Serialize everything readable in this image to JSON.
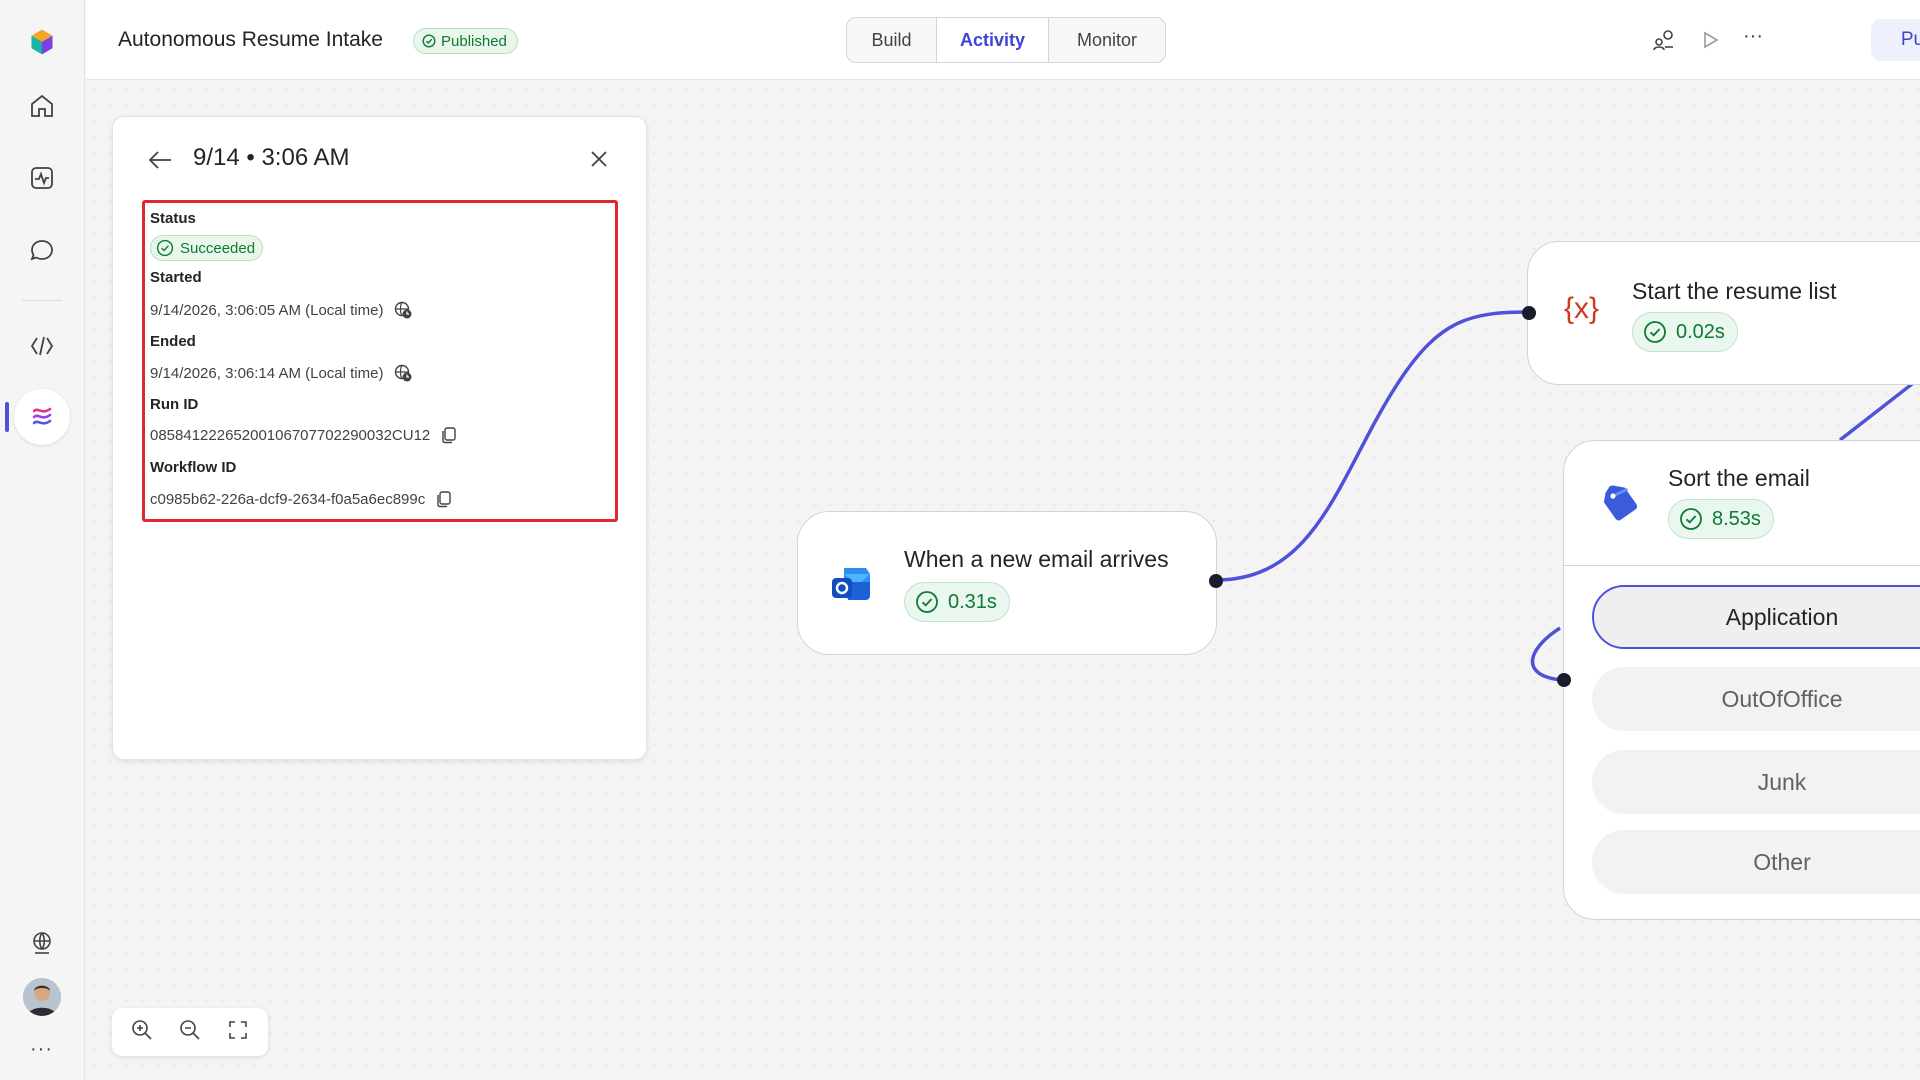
{
  "app": {
    "title": "Autonomous Resume Intake",
    "status_badge": "Published"
  },
  "tabs": [
    {
      "label": "Build",
      "active": false
    },
    {
      "label": "Activity",
      "active": true
    },
    {
      "label": "Monitor",
      "active": false
    }
  ],
  "toolbar": {
    "publish_label": "Publish",
    "more_label": "···"
  },
  "rail": {
    "more_label": "···"
  },
  "run_panel": {
    "title": "9/14 • 3:06 AM",
    "status_label": "Status",
    "status_value": "Succeeded",
    "started_label": "Started",
    "started_value": "9/14/2026, 3:06:05 AM (Local time)",
    "ended_label": "Ended",
    "ended_value": "9/14/2026, 3:06:14 AM (Local time)",
    "run_id_label": "Run ID",
    "run_id_value": "08584122265200106707702290032CU12",
    "workflow_id_label": "Workflow ID",
    "workflow_id_value": "c0985b62-226a-dcf9-2634-f0a5a6ec899c"
  },
  "nodes": {
    "trigger": {
      "title": "When a new email arrives",
      "duration": "0.31s"
    },
    "start_list": {
      "icon_text": "{x}",
      "title": "Start the resume list",
      "duration": "0.02s"
    },
    "sort_email": {
      "title": "Sort the email",
      "duration": "8.53s"
    }
  },
  "branches": [
    "Application",
    "OutOfOffice",
    "Junk",
    "Other"
  ],
  "colors": {
    "accent": "#4f52d9",
    "success": "#0e7a32",
    "highlight": "#e0262e"
  }
}
